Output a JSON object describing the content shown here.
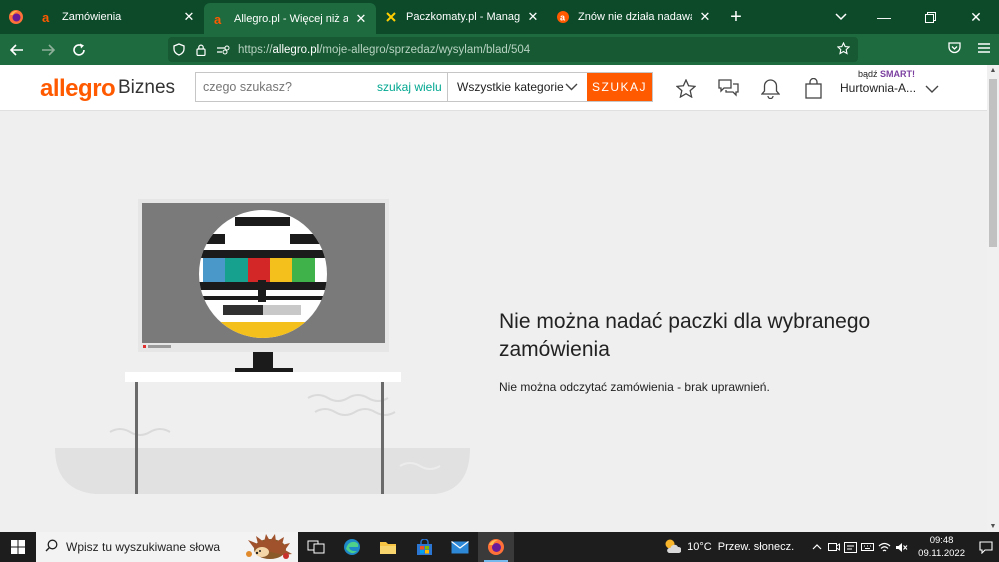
{
  "browser": {
    "tabs": [
      {
        "title": "Zamówienia",
        "active": false
      },
      {
        "title": "Allegro.pl - Więcej niż aukcje. Naj",
        "active": true
      },
      {
        "title": "Paczkomaty.pl - Manager przesył",
        "active": false
      },
      {
        "title": "Znów nie działa nadawanie wysył",
        "active": false
      }
    ],
    "url_prefix": "https://",
    "url_domain": "allegro.pl",
    "url_path": "/moje-allegro/sprzedaz/wysylam/blad/504"
  },
  "header": {
    "logo": "allegro",
    "logo_suffix": "Biznes",
    "search_placeholder": "czego szukasz?",
    "search_many": "szukaj wielu",
    "category": "Wszystkie kategorie",
    "search_button": "SZUKAJ",
    "smart_prefix": "bądź",
    "smart_label": "SMART!",
    "account": "Hurtownia-A..."
  },
  "content": {
    "title": "Nie można nadać paczki dla wybranego zamówienia",
    "message": "Nie można odczytać zamówienia - brak uprawnień."
  },
  "taskbar": {
    "search_placeholder": "Wpisz tu wyszukiwane słowa",
    "temperature": "10°C",
    "weather": "Przew. słonecz.",
    "time": "09:48",
    "date": "09.11.2022"
  },
  "colors": {
    "brand": "#ff5a00",
    "browser_dark": "#0c4a2a",
    "browser_mid": "#1d6b3e",
    "teal": "#00a790"
  }
}
